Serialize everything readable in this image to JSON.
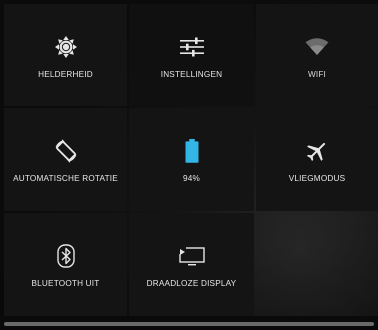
{
  "quick_settings": {
    "tiles": [
      {
        "label": "HELDERHEID",
        "icon": "brightness-icon"
      },
      {
        "label": "INSTELLINGEN",
        "icon": "settings-sliders-icon"
      },
      {
        "label": "WIFI",
        "icon": "wifi-icon"
      },
      {
        "label": "AUTOMATISCHE ROTATIE",
        "icon": "auto-rotate-icon"
      },
      {
        "label": "94%",
        "icon": "battery-icon"
      },
      {
        "label": "VLIEGMODUS",
        "icon": "airplane-icon"
      },
      {
        "label": "BLUETOOTH UIT",
        "icon": "bluetooth-icon"
      },
      {
        "label": "DRAADLOZE DISPLAY",
        "icon": "cast-screen-icon"
      }
    ]
  },
  "colors": {
    "battery_accent": "#33b5e5",
    "icon_default": "#e6e6e6",
    "wifi_dim": "#6c6c6c"
  },
  "battery": {
    "level_percent": 94
  }
}
